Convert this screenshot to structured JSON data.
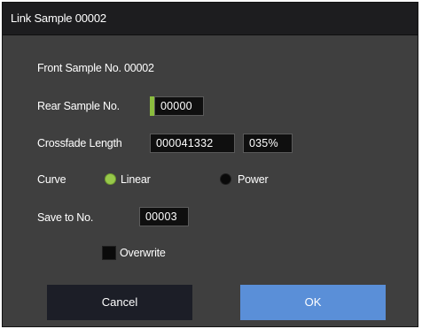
{
  "dialog": {
    "title": "Link Sample 00002",
    "front_sample": "Front Sample No. 00002",
    "rear_sample_label": "Rear Sample No.",
    "rear_sample_value": "00000",
    "crossfade_label": "Crossfade Length",
    "crossfade_value": "000041332",
    "crossfade_percent": "035%",
    "curve_label": "Curve",
    "curve_options": [
      "Linear",
      "Power"
    ],
    "curve_selected": "Linear",
    "save_to_label": "Save to No.",
    "save_to_value": "00003",
    "overwrite_label": "Overwrite",
    "overwrite_checked": false,
    "cancel_label": "Cancel",
    "ok_label": "OK"
  },
  "colors": {
    "dialog_bg": "#3f3f3f",
    "titlebar_bg": "#1d1d1f",
    "accent_green": "#97c84a",
    "ok_blue": "#5a8fd8",
    "cancel_dark": "#1c1e27"
  }
}
